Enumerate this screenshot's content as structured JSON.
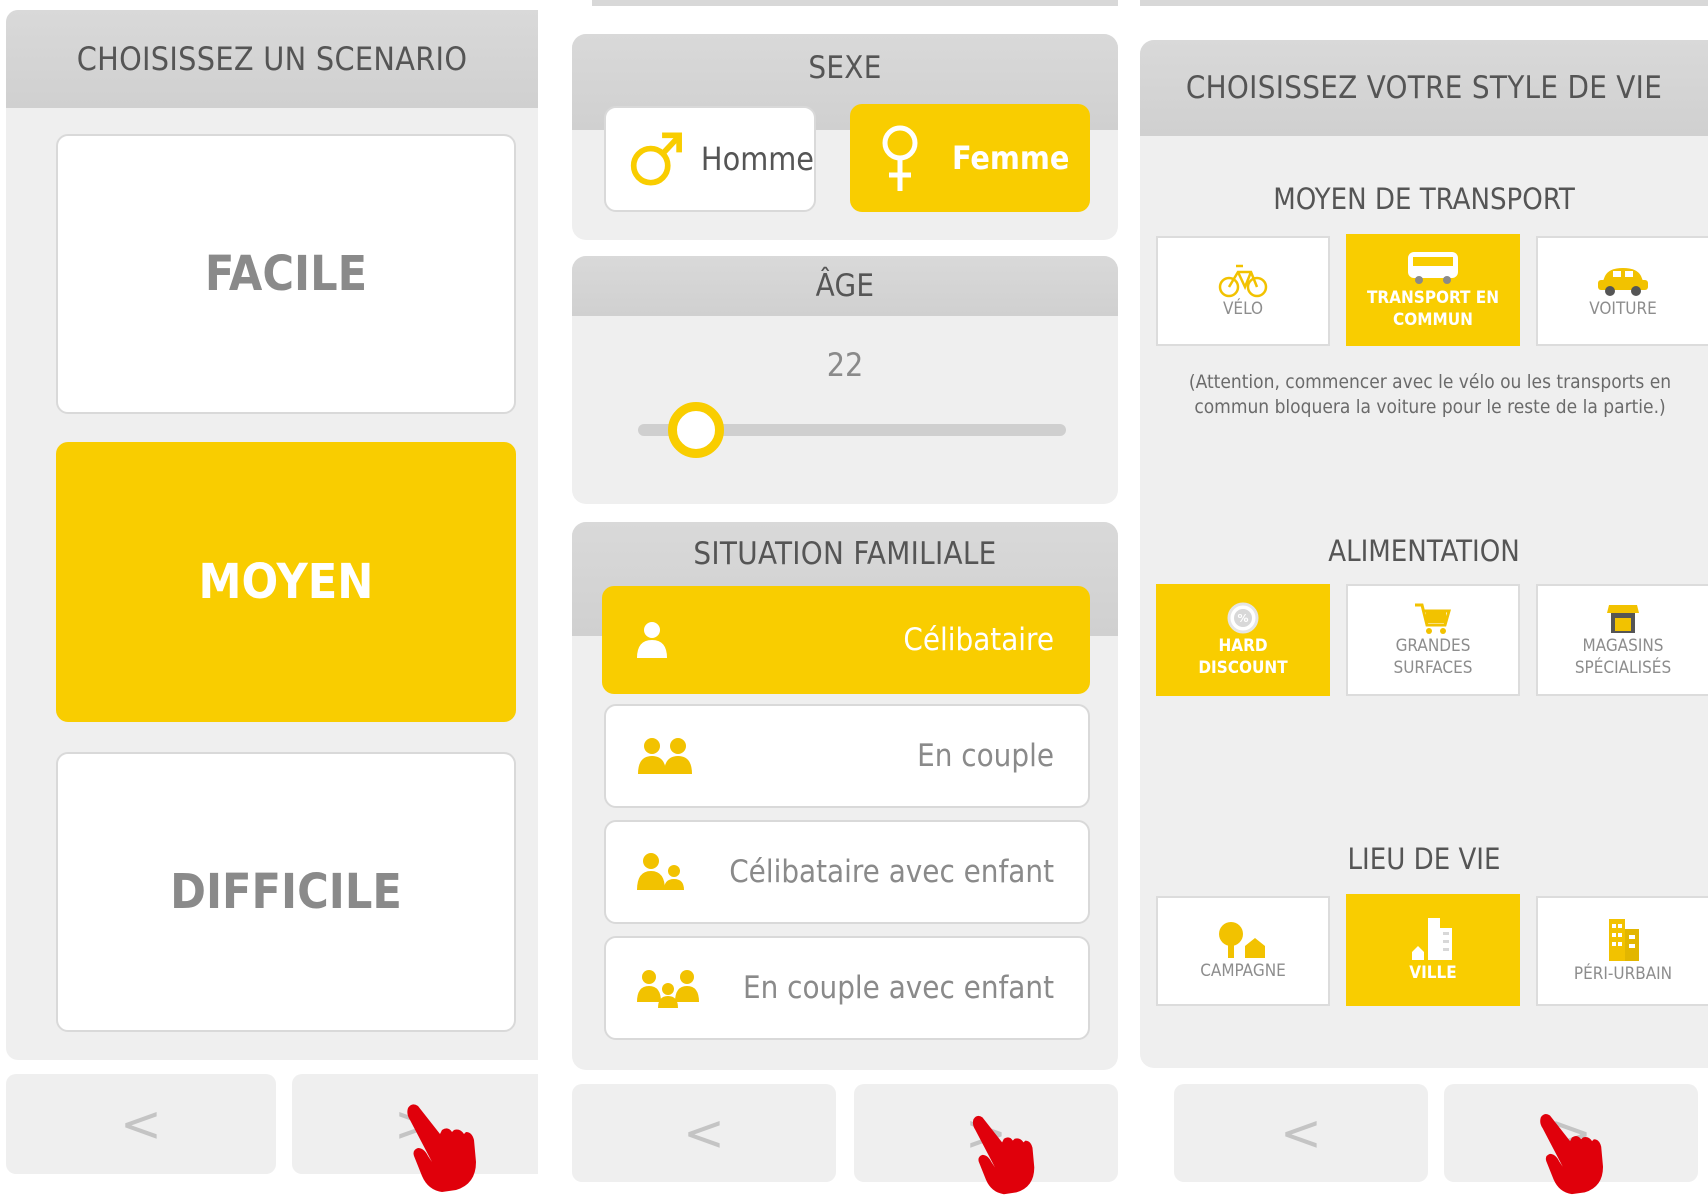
{
  "colors": {
    "accent": "#f9cd00",
    "panel": "#efefef",
    "header": "#d3d3d3",
    "hand": "#e0000b"
  },
  "scenario": {
    "title": "CHOISISSEZ UN SCENARIO",
    "options": [
      {
        "label": "FACILE",
        "selected": false
      },
      {
        "label": "MOYEN",
        "selected": true
      },
      {
        "label": "DIFFICILE",
        "selected": false
      }
    ],
    "prev_label": "<",
    "next_label": ">"
  },
  "profile": {
    "sex": {
      "title": "SEXE",
      "male_label": "Homme",
      "female_label": "Femme",
      "male_icon": "male-symbol-icon",
      "female_icon": "female-symbol-icon",
      "selected": "Femme"
    },
    "age": {
      "title": "ÂGE",
      "value": "22",
      "slider_fraction": 0.08
    },
    "family": {
      "title": "SITUATION FAMILIALE",
      "options": [
        {
          "label": "Célibataire",
          "icon": "person-icon",
          "selected": true
        },
        {
          "label": "En couple",
          "icon": "couple-icon",
          "selected": false
        },
        {
          "label": "Célibataire avec enfant",
          "icon": "parent-child-icon",
          "selected": false
        },
        {
          "label": "En couple avec enfant",
          "icon": "family-icon",
          "selected": false
        }
      ]
    },
    "prev_label": "<",
    "next_label": ">"
  },
  "lifestyle": {
    "title": "CHOISISSEZ VOTRE STYLE DE VIE",
    "transport": {
      "title": "MOYEN DE TRANSPORT",
      "options": [
        {
          "label": "VÉLO",
          "icon": "bicycle-icon",
          "selected": false
        },
        {
          "label": "TRANSPORT EN COMMUN",
          "icon": "bus-icon",
          "selected": true
        },
        {
          "label": "VOITURE",
          "icon": "car-icon",
          "selected": false
        }
      ],
      "note": "(Attention, commencer avec le vélo ou les transports en commun bloquera la voiture pour le reste de la partie.)"
    },
    "food": {
      "title": "ALIMENTATION",
      "options": [
        {
          "label": "HARD DISCOUNT",
          "icon": "discount-tag-icon",
          "selected": true
        },
        {
          "label": "GRANDES SURFACES",
          "icon": "shopping-cart-icon",
          "selected": false
        },
        {
          "label": "MAGASINS SPÉCIALISÉS",
          "icon": "storefront-icon",
          "selected": false
        }
      ]
    },
    "home": {
      "title": "LIEU DE VIE",
      "options": [
        {
          "label": "CAMPAGNE",
          "icon": "tree-house-icon",
          "selected": false
        },
        {
          "label": "VILLE",
          "icon": "city-buildings-icon",
          "selected": true
        },
        {
          "label": "PÉRI-URBAIN",
          "icon": "suburb-buildings-icon",
          "selected": false
        }
      ]
    },
    "prev_label": "<",
    "next_label": ">"
  }
}
